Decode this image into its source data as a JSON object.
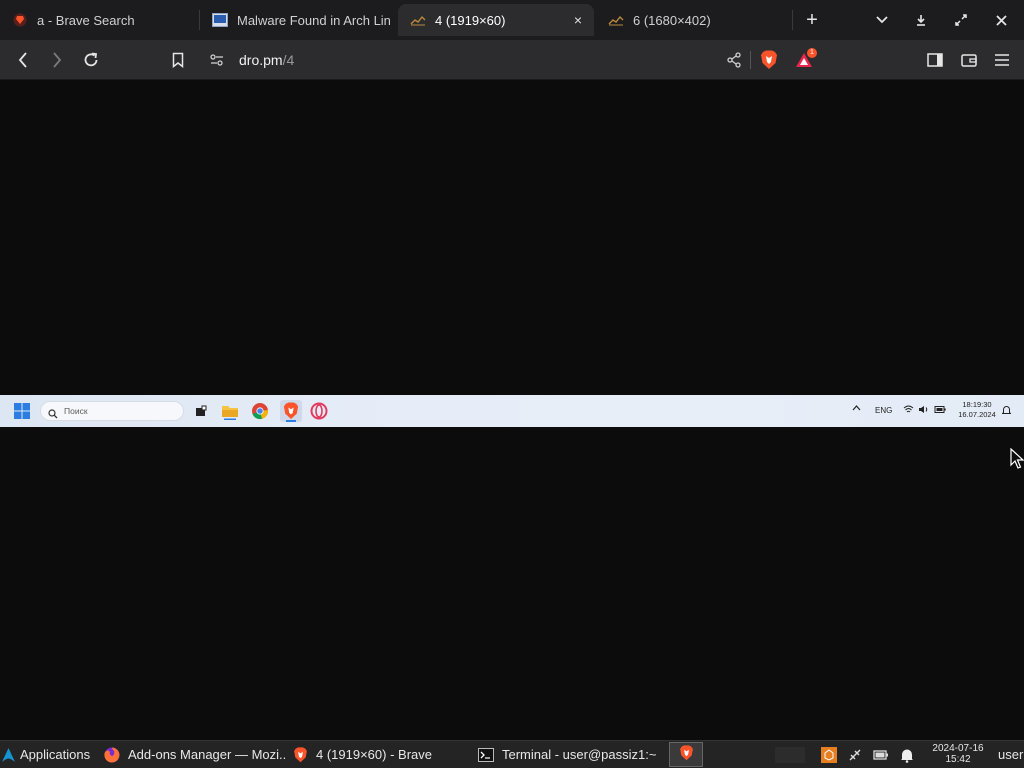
{
  "browser": {
    "tabs": [
      {
        "title": "a - Brave Search",
        "favicon": "brave-search-icon",
        "active": false
      },
      {
        "title": "Malware Found in Arch Lin",
        "favicon": "news-page-icon",
        "active": false
      },
      {
        "title": "4 (1919×60)",
        "favicon": "image-icon",
        "active": true,
        "close": "×"
      },
      {
        "title": "6 (1680×402)",
        "favicon": "image-icon",
        "active": false
      }
    ],
    "new_tab_label": "+",
    "url_host": "dro.pm",
    "url_path": "/4",
    "notifications_badge": "1",
    "colors": {
      "tabstrip": "#1c1c1e",
      "toolbar": "#2c2c2e",
      "brave_orange": "#fb542b"
    }
  },
  "shown_image": {
    "search_placeholder": "Поиск",
    "lang": "ENG",
    "time": "18:19:30",
    "date": "16.07.2024"
  },
  "taskbar": {
    "applications_label": "Applications",
    "items": [
      {
        "label": "Add-ons Manager — Mozi...",
        "icon": "firefox-icon"
      },
      {
        "label": "4 (1919×60) - Brave",
        "icon": "brave-icon"
      },
      {
        "label": "Terminal - user@passiz1:~",
        "icon": "terminal-icon"
      }
    ],
    "clock_date": "2024-07-16",
    "clock_time": "15:42",
    "user": "user"
  }
}
